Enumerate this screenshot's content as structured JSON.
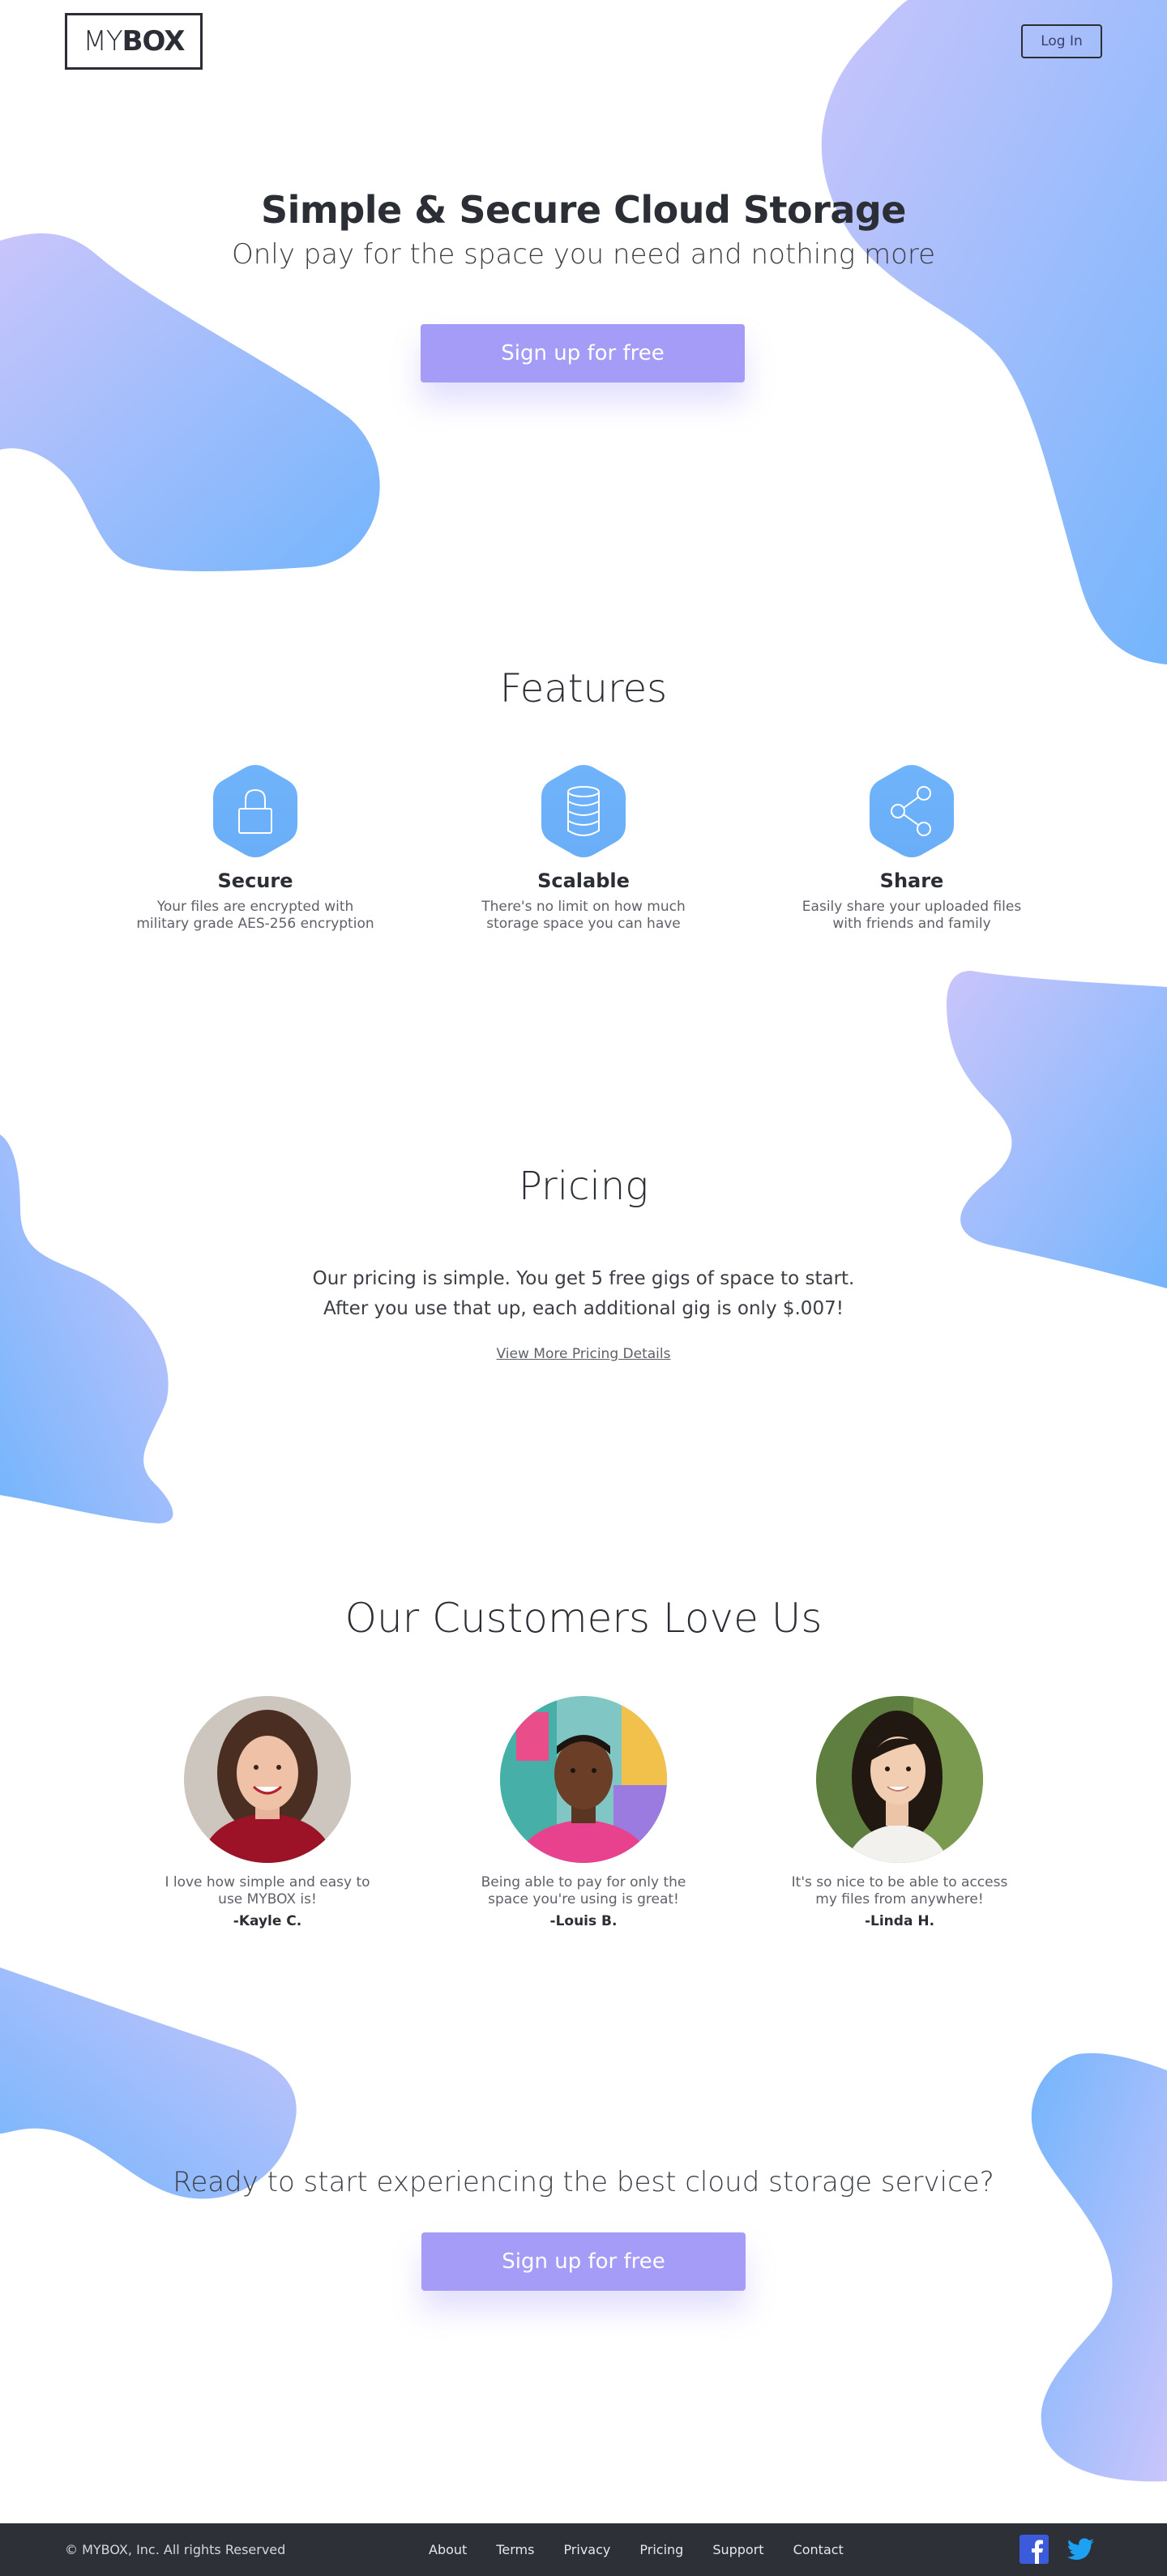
{
  "header": {
    "logo_light": "MY",
    "logo_bold": "BOX",
    "login_label": "Log In"
  },
  "hero": {
    "title": "Simple & Secure Cloud Storage",
    "subtitle": "Only pay for the space you need and nothing more",
    "cta_label": "Sign up for free"
  },
  "features": {
    "title": "Features",
    "items": [
      {
        "icon": "lock-icon",
        "title": "Secure",
        "description": "Your files are encrypted with military grade AES-256 encryption"
      },
      {
        "icon": "database-icon",
        "title": "Scalable",
        "description": "There's no limit on how much storage space you can have"
      },
      {
        "icon": "share-icon",
        "title": "Share",
        "description": "Easily share your uploaded files with friends and family"
      }
    ]
  },
  "pricing": {
    "title": "Pricing",
    "line1": "Our pricing is simple. You get 5 free gigs of space to start.",
    "line2": "After you use that up, each additional gig is only $.007!",
    "link_label": "View More Pricing Details"
  },
  "testimonials": {
    "title": "Our Customers Love Us",
    "items": [
      {
        "quote": "I love how simple and easy to use MYBOX is!",
        "author": "-Kayle C."
      },
      {
        "quote": "Being able to pay for only the space you're using is great!",
        "author": "-Louis B."
      },
      {
        "quote": "It's so nice to be able to access my files from anywhere!",
        "author": "-Linda H."
      }
    ]
  },
  "bottom_cta": {
    "headline": "Ready to start experiencing the best cloud storage service?",
    "cta_label": "Sign up for free"
  },
  "footer": {
    "copyright": "© MYBOX, Inc. All rights Reserved",
    "links": [
      "About",
      "Terms",
      "Privacy",
      "Pricing",
      "Support",
      "Contact"
    ],
    "social": [
      "facebook-icon",
      "twitter-icon"
    ]
  },
  "colors": {
    "accent": "#a59cf7",
    "blob_blue": "#74b5fc",
    "blob_lavender": "#c9c5fb",
    "footer_bg": "#2d3036",
    "text_dark": "#2b2e34"
  }
}
